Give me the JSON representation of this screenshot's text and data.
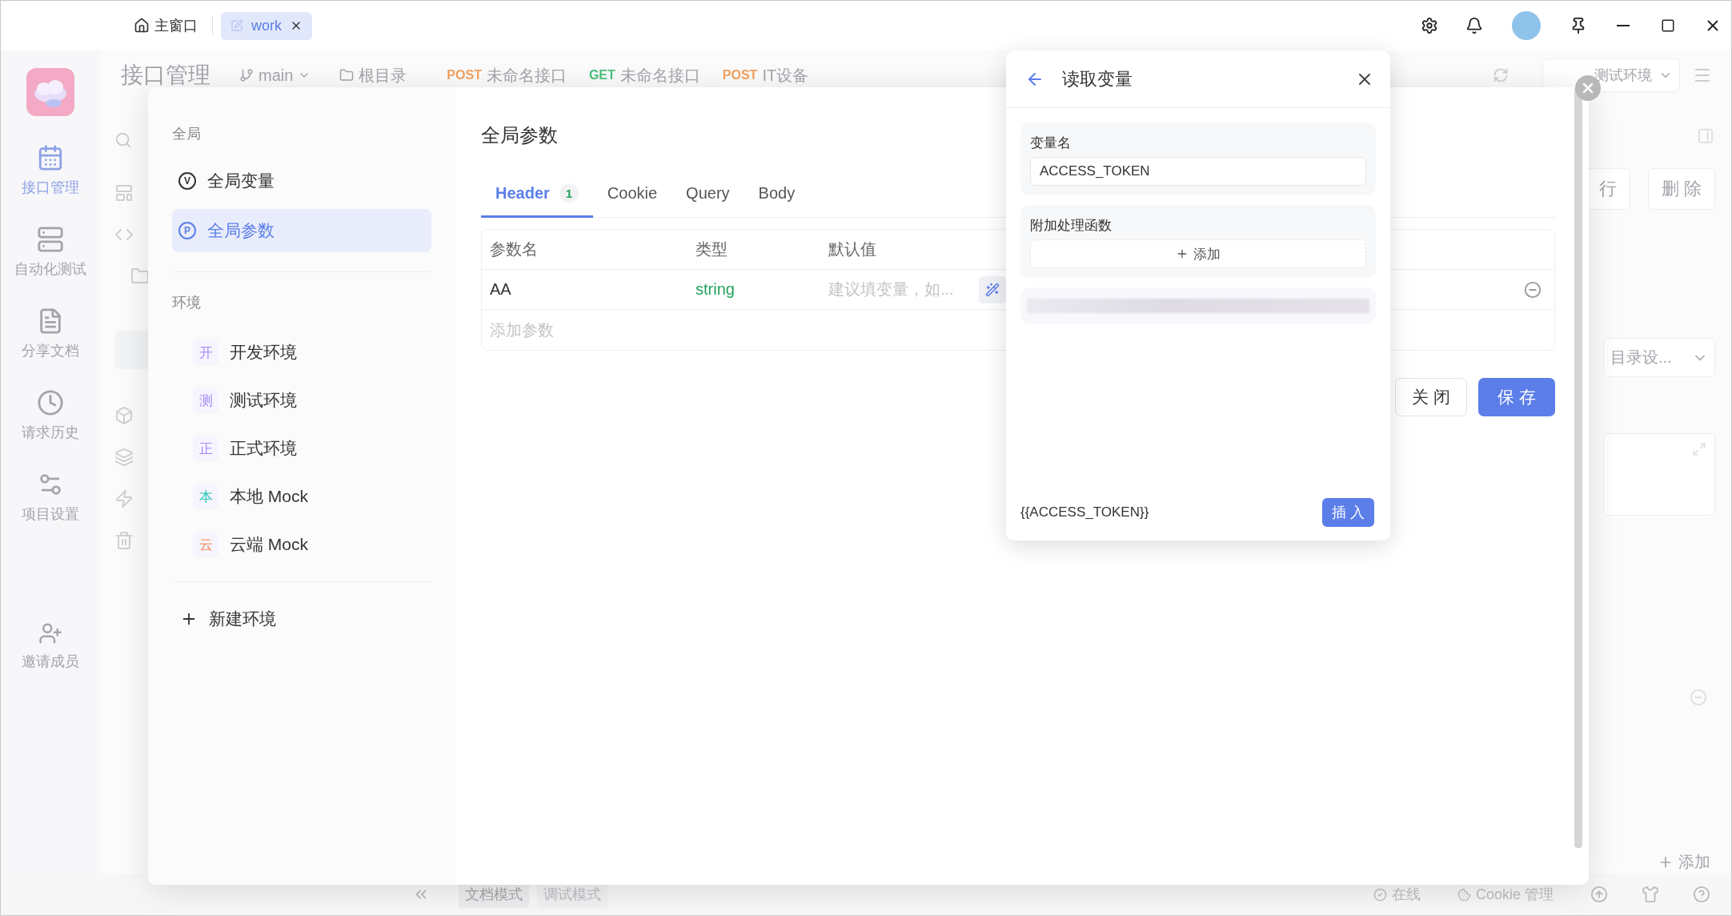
{
  "titlebar": {
    "home_tab": "主窗口",
    "tabs": [
      {
        "label": "work",
        "selected": true
      }
    ]
  },
  "nav": {
    "items": [
      {
        "label": "接口管理",
        "selected": true
      },
      {
        "label": "自动化测试",
        "selected": false
      },
      {
        "label": "分享文档",
        "selected": false
      },
      {
        "label": "请求历史",
        "selected": false
      },
      {
        "label": "项目设置",
        "selected": false
      }
    ],
    "invite": "邀请成员"
  },
  "header": {
    "title": "接口管理",
    "branch": "main",
    "folder": "根目录",
    "request_tabs": [
      {
        "method": "POST",
        "name": "未命名接口",
        "color": "#f5a25d"
      },
      {
        "method": "GET",
        "name": "未命名接口",
        "color": "#4cc07a"
      },
      {
        "method": "POST",
        "name": "IT设备",
        "color": "#f5a25d"
      }
    ],
    "environment": "测试环境"
  },
  "side_tree": {
    "items": [
      {
        "kind": "project"
      },
      {
        "kind": "api"
      },
      {
        "kind": "folder"
      },
      {
        "kind": "blank"
      },
      {
        "kind": "data"
      },
      {
        "kind": "group"
      },
      {
        "kind": "quick"
      },
      {
        "kind": "trash"
      }
    ]
  },
  "right_panel": {
    "run_button": "行",
    "delete_button": "删 除",
    "directory_select": "目录设...",
    "add_button": "添加"
  },
  "bottom_bar": {
    "mode_tabs": [
      {
        "label": "文档模式",
        "selected": true
      },
      {
        "label": "调试模式",
        "selected": false
      }
    ],
    "online": "在线",
    "cookie": "Cookie 管理"
  },
  "modal": {
    "sidebar": {
      "global_heading": "全局",
      "global_items": [
        {
          "icon": "V",
          "label": "全局变量",
          "selected": false
        },
        {
          "icon": "P",
          "label": "全局参数",
          "selected": true
        }
      ],
      "env_heading": "环境",
      "environments": [
        {
          "badge": "开",
          "label": "开发环境",
          "color": "#a78bfa"
        },
        {
          "badge": "测",
          "label": "测试环境",
          "color": "#a78bfa"
        },
        {
          "badge": "正",
          "label": "正式环境",
          "color": "#a78bfa"
        },
        {
          "badge": "本",
          "label": "本地 Mock",
          "color": "#2dc6b6"
        },
        {
          "badge": "云",
          "label": "云端 Mock",
          "color": "#f5875a"
        }
      ],
      "new_env": "新建环境"
    },
    "title": "全局参数",
    "tabs": [
      {
        "label": "Header",
        "count": "1",
        "selected": true
      },
      {
        "label": "Cookie",
        "selected": false
      },
      {
        "label": "Query",
        "selected": false
      },
      {
        "label": "Body",
        "selected": false
      }
    ],
    "table": {
      "columns": [
        "参数名",
        "类型",
        "默认值"
      ],
      "rows": [
        {
          "name": "AA",
          "type": "string",
          "placeholder": "建议填变量，如..."
        }
      ],
      "add_row": "添加参数"
    },
    "buttons": {
      "close": "关 闭",
      "save": "保 存"
    }
  },
  "popup": {
    "title": "读取变量",
    "variable_label": "变量名",
    "variable_value": "ACCESS_TOKEN",
    "function_label": "附加处理函数",
    "add_function": "添加",
    "preview": "{{ACCESS_TOKEN}}",
    "insert_button": "插 入"
  }
}
